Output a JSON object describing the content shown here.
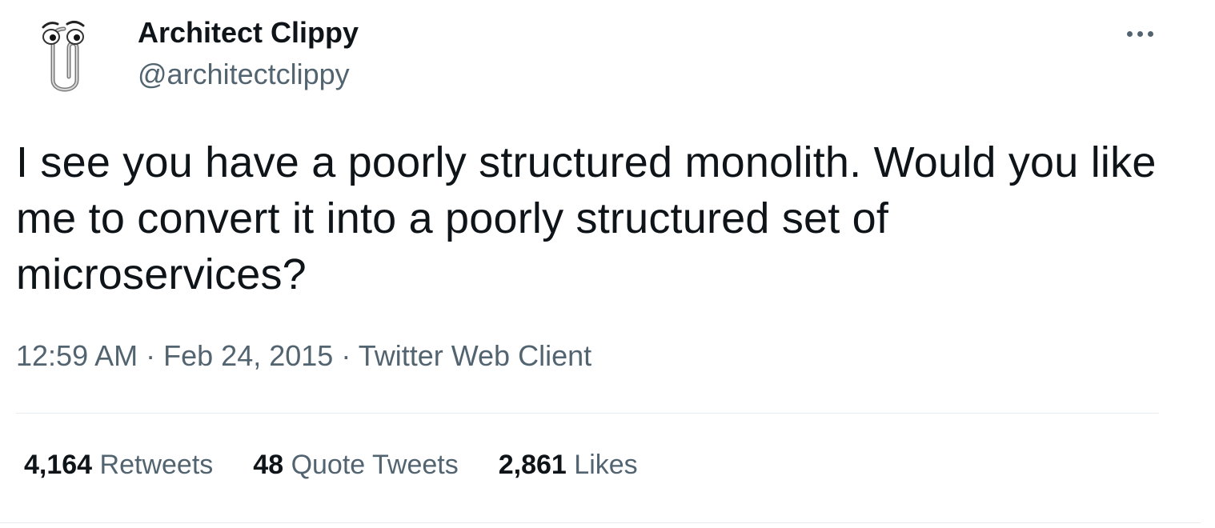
{
  "author": {
    "display_name": "Architect Clippy",
    "handle": "@architectclippy",
    "avatar_icon": "paperclip-mascot-icon"
  },
  "menu_icon": "more-horizontal-icon",
  "tweet": {
    "text": "I see you have a poorly structured monolith. Would you like me to convert it into a poorly structured set of microservices?",
    "time": "12:59 AM",
    "separator": "·",
    "date": "Feb 24, 2015",
    "source": "Twitter Web Client"
  },
  "stats": {
    "retweets_count": "4,164",
    "retweets_label": "Retweets",
    "quotes_count": "48",
    "quotes_label": "Quote Tweets",
    "likes_count": "2,861",
    "likes_label": "Likes"
  },
  "colors": {
    "text_primary": "#0f1419",
    "text_secondary": "#536471",
    "divider": "#e6ecf0",
    "background": "#ffffff"
  }
}
